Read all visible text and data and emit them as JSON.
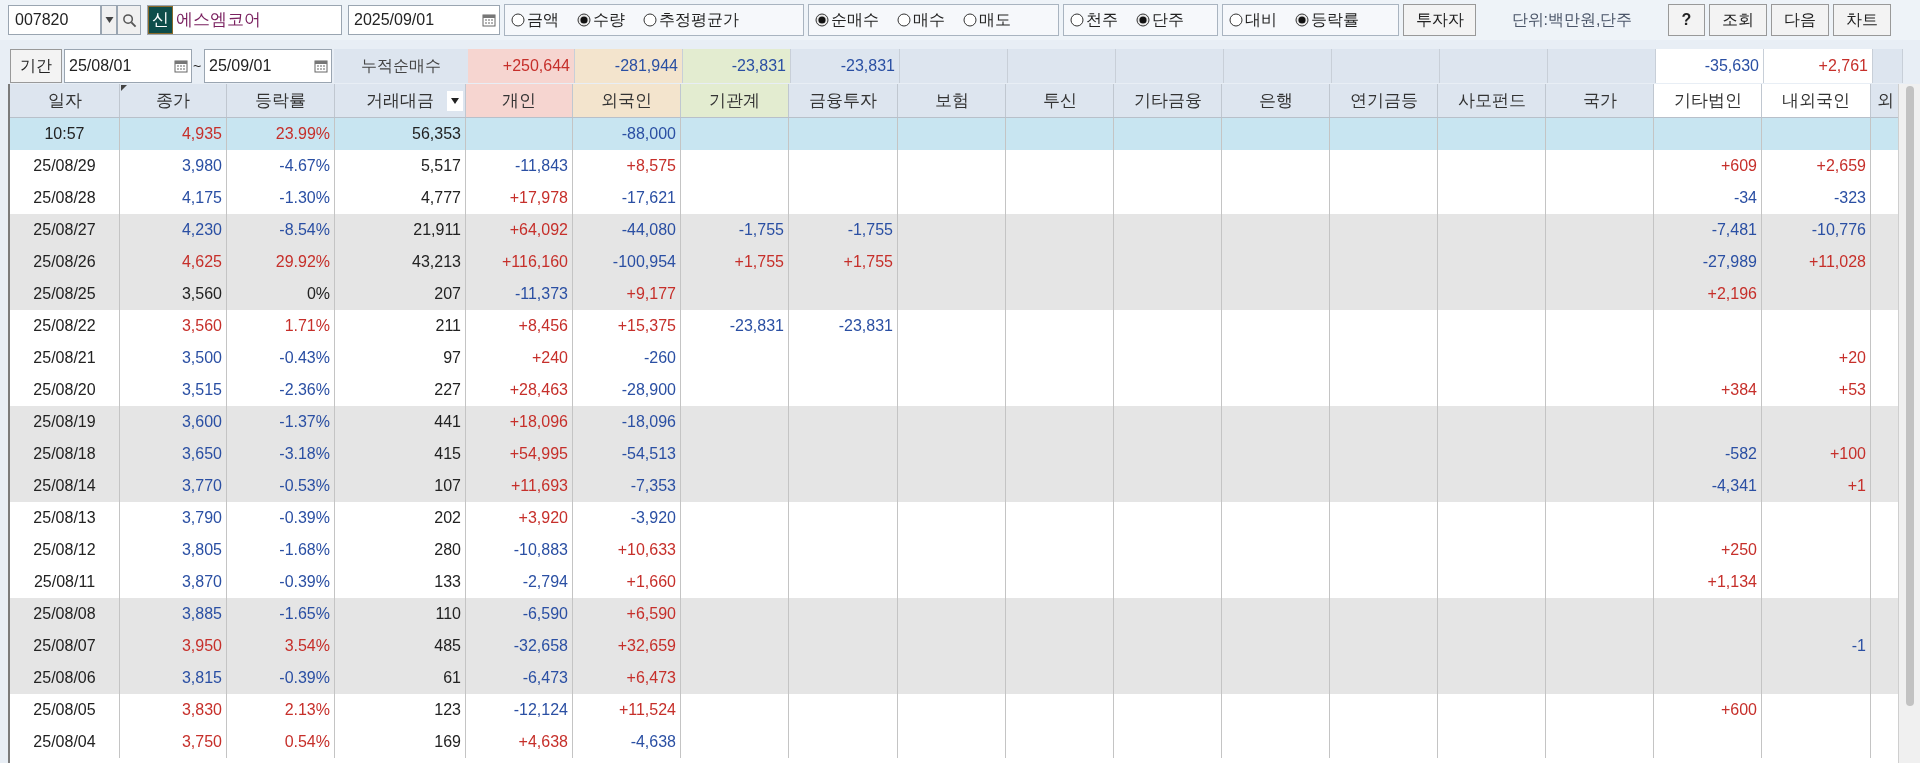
{
  "toolbar": {
    "stock_code": "007820",
    "credit_badge": "신",
    "stock_name": "에스엠코어",
    "date": "2025/09/01",
    "radio_groups": [
      {
        "options": [
          {
            "label": "금액",
            "selected": false
          },
          {
            "label": "수량",
            "selected": true
          },
          {
            "label": "추정평균가",
            "selected": false
          }
        ]
      },
      {
        "options": [
          {
            "label": "순매수",
            "selected": true
          },
          {
            "label": "매수",
            "selected": false
          },
          {
            "label": "매도",
            "selected": false
          }
        ]
      },
      {
        "options": [
          {
            "label": "천주",
            "selected": false
          },
          {
            "label": "단주",
            "selected": true
          }
        ]
      },
      {
        "options": [
          {
            "label": "대비",
            "selected": false
          },
          {
            "label": "등락률",
            "selected": true
          }
        ]
      }
    ],
    "investor_button": "투자자",
    "unit_label": "단위:백만원,단주",
    "help_button": "?",
    "buttons": [
      "조회",
      "다음",
      "차트"
    ]
  },
  "period": {
    "button": "기간",
    "from": "25/08/01",
    "separator": "~",
    "to": "25/09/01",
    "total_label": "누적순매수"
  },
  "table": {
    "columns": [
      {
        "label": "일자",
        "kind": "plain",
        "color": "#dde5ef"
      },
      {
        "label": "종가",
        "kind": "marked",
        "color": "#dde5ef"
      },
      {
        "label": "등락률",
        "kind": "plain",
        "color": "#dde5ef"
      },
      {
        "label": "거래대금",
        "kind": "dropdown",
        "color": "#dde5ef"
      },
      {
        "label": "개인",
        "kind": "plain",
        "color": "#f6d5d0",
        "total": "+250,644"
      },
      {
        "label": "외국인",
        "kind": "plain",
        "color": "#f3e4cd",
        "total": "-281,944"
      },
      {
        "label": "기관계",
        "kind": "plain",
        "color": "#e3ecd0",
        "total": "-23,831"
      },
      {
        "label": "금융투자",
        "kind": "plain",
        "color": "#dde5ef",
        "total": "-23,831"
      },
      {
        "label": "보험",
        "kind": "plain",
        "color": "#dde5ef"
      },
      {
        "label": "투신",
        "kind": "plain",
        "color": "#dde5ef"
      },
      {
        "label": "기타금융",
        "kind": "plain",
        "color": "#dde5ef"
      },
      {
        "label": "은행",
        "kind": "plain",
        "color": "#dde5ef"
      },
      {
        "label": "연기금등",
        "kind": "plain",
        "color": "#dde5ef"
      },
      {
        "label": "사모펀드",
        "kind": "plain",
        "color": "#dde5ef"
      },
      {
        "label": "국가",
        "kind": "plain",
        "color": "#dde5ef"
      },
      {
        "label": "기타법인",
        "kind": "plain",
        "color": "#ffffff",
        "total": "-35,630"
      },
      {
        "label": "내외국인",
        "kind": "plain",
        "color": "#ffffff",
        "total": "+2,761"
      },
      {
        "label": "외",
        "kind": "plain",
        "color": "#dde5ef"
      }
    ],
    "rows": [
      {
        "current": true,
        "cells": [
          "10:57",
          "4,935",
          "23.99%",
          "56,353",
          null,
          "-88,000"
        ]
      },
      {
        "current": false,
        "shaded": false,
        "cells": [
          "25/08/29",
          "3,980",
          "-4.67%",
          "5,517",
          "-11,843",
          "+8,575",
          null,
          null,
          null,
          null,
          null,
          null,
          null,
          null,
          null,
          "+609",
          "+2,659"
        ]
      },
      {
        "current": false,
        "shaded": false,
        "cells": [
          "25/08/28",
          "4,175",
          "-1.30%",
          "4,777",
          "+17,978",
          "-17,621",
          null,
          null,
          null,
          null,
          null,
          null,
          null,
          null,
          null,
          "-34",
          "-323"
        ]
      },
      {
        "current": false,
        "shaded": true,
        "cells": [
          "25/08/27",
          "4,230",
          "-8.54%",
          "21,911",
          "+64,092",
          "-44,080",
          "-1,755",
          "-1,755",
          null,
          null,
          null,
          null,
          null,
          null,
          null,
          "-7,481",
          "-10,776"
        ]
      },
      {
        "current": false,
        "shaded": true,
        "cells": [
          "25/08/26",
          "4,625",
          "29.92%",
          "43,213",
          "+116,160",
          "-100,954",
          "+1,755",
          "+1,755",
          null,
          null,
          null,
          null,
          null,
          null,
          null,
          "-27,989",
          "+11,028"
        ]
      },
      {
        "current": false,
        "shaded": true,
        "cells": [
          "25/08/25",
          "3,560",
          "0%",
          "207",
          "-11,373",
          "+9,177",
          null,
          null,
          null,
          null,
          null,
          null,
          null,
          null,
          null,
          "+2,196"
        ]
      },
      {
        "current": false,
        "shaded": false,
        "cells": [
          "25/08/22",
          "3,560",
          "1.71%",
          "211",
          "+8,456",
          "+15,375",
          "-23,831",
          "-23,831"
        ]
      },
      {
        "current": false,
        "shaded": false,
        "cells": [
          "25/08/21",
          "3,500",
          "-0.43%",
          "97",
          "+240",
          "-260",
          null,
          null,
          null,
          null,
          null,
          null,
          null,
          null,
          null,
          null,
          "+20"
        ]
      },
      {
        "current": false,
        "shaded": false,
        "cells": [
          "25/08/20",
          "3,515",
          "-2.36%",
          "227",
          "+28,463",
          "-28,900",
          null,
          null,
          null,
          null,
          null,
          null,
          null,
          null,
          null,
          "+384",
          "+53"
        ]
      },
      {
        "current": false,
        "shaded": true,
        "cells": [
          "25/08/19",
          "3,600",
          "-1.37%",
          "441",
          "+18,096",
          "-18,096"
        ]
      },
      {
        "current": false,
        "shaded": true,
        "cells": [
          "25/08/18",
          "3,650",
          "-3.18%",
          "415",
          "+54,995",
          "-54,513",
          null,
          null,
          null,
          null,
          null,
          null,
          null,
          null,
          null,
          "-582",
          "+100"
        ]
      },
      {
        "current": false,
        "shaded": true,
        "cells": [
          "25/08/14",
          "3,770",
          "-0.53%",
          "107",
          "+11,693",
          "-7,353",
          null,
          null,
          null,
          null,
          null,
          null,
          null,
          null,
          null,
          "-4,341",
          "+1"
        ]
      },
      {
        "current": false,
        "shaded": false,
        "cells": [
          "25/08/13",
          "3,790",
          "-0.39%",
          "202",
          "+3,920",
          "-3,920"
        ]
      },
      {
        "current": false,
        "shaded": false,
        "cells": [
          "25/08/12",
          "3,805",
          "-1.68%",
          "280",
          "-10,883",
          "+10,633",
          null,
          null,
          null,
          null,
          null,
          null,
          null,
          null,
          null,
          "+250"
        ]
      },
      {
        "current": false,
        "shaded": false,
        "cells": [
          "25/08/11",
          "3,870",
          "-0.39%",
          "133",
          "-2,794",
          "+1,660",
          null,
          null,
          null,
          null,
          null,
          null,
          null,
          null,
          null,
          "+1,134"
        ]
      },
      {
        "current": false,
        "shaded": true,
        "cells": [
          "25/08/08",
          "3,885",
          "-1.65%",
          "110",
          "-6,590",
          "+6,590"
        ]
      },
      {
        "current": false,
        "shaded": true,
        "cells": [
          "25/08/07",
          "3,950",
          "3.54%",
          "485",
          "-32,658",
          "+32,659",
          null,
          null,
          null,
          null,
          null,
          null,
          null,
          null,
          null,
          null,
          "-1"
        ]
      },
      {
        "current": false,
        "shaded": true,
        "cells": [
          "25/08/06",
          "3,815",
          "-0.39%",
          "61",
          "-6,473",
          "+6,473"
        ]
      },
      {
        "current": false,
        "shaded": false,
        "cells": [
          "25/08/05",
          "3,830",
          "2.13%",
          "123",
          "-12,124",
          "+11,524",
          null,
          null,
          null,
          null,
          null,
          null,
          null,
          null,
          null,
          "+600"
        ]
      },
      {
        "current": false,
        "shaded": false,
        "cells": [
          "25/08/04",
          "3,750",
          "0.54%",
          "169",
          "+4,638",
          "-4,638"
        ]
      }
    ]
  }
}
